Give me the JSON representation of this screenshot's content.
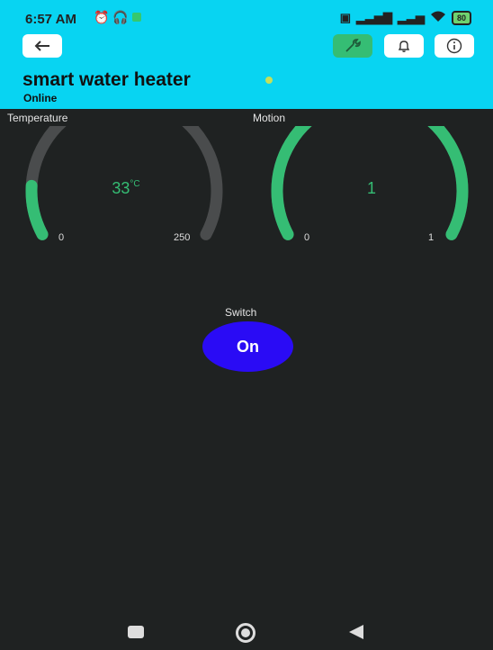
{
  "status_bar": {
    "time": "6:57 AM",
    "battery": "80",
    "icons_left": [
      "alarm-icon",
      "headset-icon",
      "app-notification-icon"
    ],
    "icons_right": [
      "screenshot-icon",
      "signal-icon",
      "signal-icon",
      "wifi-icon",
      "battery-icon"
    ]
  },
  "toolbar": {
    "back_icon": "arrow-left-icon",
    "wrench_icon": "wrench-icon",
    "bell_icon": "bell-icon",
    "info_icon": "info-icon"
  },
  "device": {
    "name": "smart water heater",
    "status": "Online",
    "status_color": "#c4e05a"
  },
  "gauges": [
    {
      "label": "Temperature",
      "value": "33",
      "unit": "°C",
      "min": "0",
      "max": "250",
      "fraction": 0.132,
      "fill_color": "#35bd74",
      "track_color": "#4a4c4d"
    },
    {
      "label": "Motion",
      "value": "1",
      "unit": "",
      "min": "0",
      "max": "1",
      "fraction": 1.0,
      "fill_color": "#35bd74",
      "track_color": "#4a4c4d"
    }
  ],
  "switch": {
    "label": "Switch",
    "state": "On",
    "color": "#2a0bf5"
  },
  "nav": {
    "recent": "square-icon",
    "home": "circle-icon",
    "back": "triangle-back-icon"
  }
}
